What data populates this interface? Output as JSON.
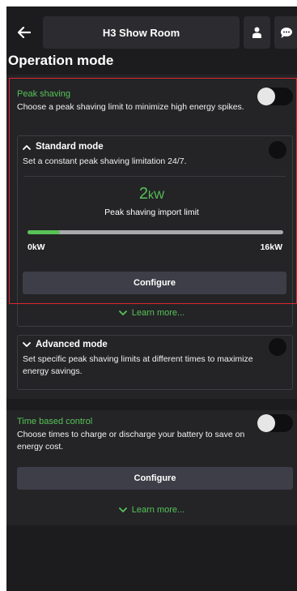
{
  "header": {
    "title": "H3 Show Room",
    "back_icon": "arrow-left-icon",
    "user_icon": "person-icon",
    "chat_icon": "chat-bubble-icon"
  },
  "page": {
    "title": "Operation mode"
  },
  "peak_shaving": {
    "title": "Peak shaving",
    "description": "Choose a peak shaving limit to minimize high energy spikes.",
    "toggle_on": false,
    "standard_mode": {
      "title": "Standard mode",
      "description": "Set a constant peak shaving limitation 24/7.",
      "value": "2",
      "unit": "kW",
      "value_label": "Peak shaving import limit",
      "slider_fraction": 0.125,
      "min_label": "0kW",
      "max_label": "16kW",
      "configure_label": "Configure"
    },
    "learn_more": "Learn more...",
    "advanced_mode": {
      "title": "Advanced mode",
      "description": "Set specific peak shaving limits at different times to maximize energy savings."
    }
  },
  "time_based": {
    "title": "Time based control",
    "description": "Choose times to charge or discharge your battery to save on energy cost.",
    "toggle_on": false,
    "configure_label": "Configure",
    "learn_more": "Learn more..."
  },
  "colors": {
    "accent": "#57c356",
    "background": "#1c1c1e",
    "panel": "#242427",
    "button": "#3d3e47",
    "highlight": "#e0262e"
  }
}
